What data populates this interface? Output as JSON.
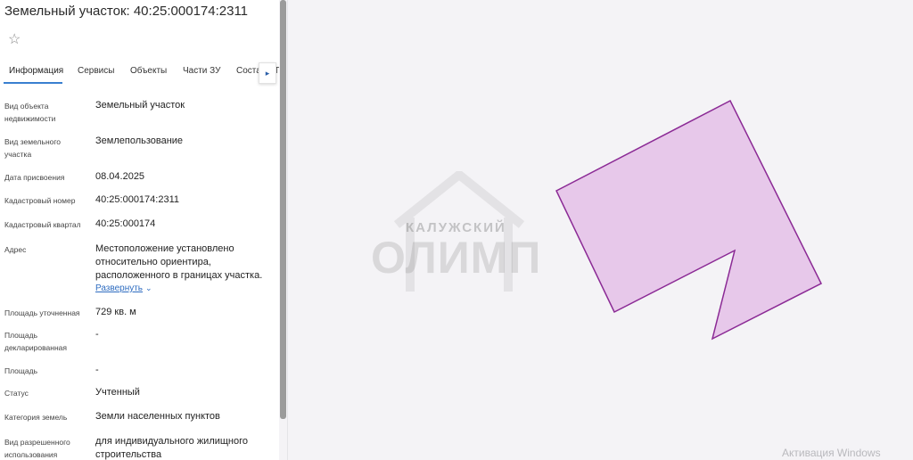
{
  "header": {
    "title": "Земельный участок: 40:25:000174:2311"
  },
  "tabs": [
    {
      "label": "Информация"
    },
    {
      "label": "Сервисы"
    },
    {
      "label": "Объекты"
    },
    {
      "label": "Части ЗУ"
    },
    {
      "label": "Соста"
    },
    {
      "label": "П"
    }
  ],
  "fields": [
    {
      "label": "Вид объекта недвижимости",
      "value": "Земельный участок"
    },
    {
      "label": "Вид земельного участка",
      "value": "Землепользование"
    },
    {
      "label": "Дата присвоения",
      "value": "08.04.2025"
    },
    {
      "label": "Кадастровый номер",
      "value": "40:25:000174:2311"
    },
    {
      "label": "Кадастровый квартал",
      "value": "40:25:000174"
    },
    {
      "label": "Адрес",
      "value": "Местоположение установлено относительно ориентира, расположенного в границах участка."
    },
    {
      "label": "Площадь уточненная",
      "value": "729 кв. м"
    },
    {
      "label": "Площадь декларированная",
      "value": "-"
    },
    {
      "label": "Площадь",
      "value": "-"
    },
    {
      "label": "Статус",
      "value": "Учтенный"
    },
    {
      "label": "Категория земель",
      "value": "Земли населенных пунктов"
    },
    {
      "label": "Вид разрешенного использования",
      "value": "для индивидуального жилищного строительства"
    }
  ],
  "address_expand": {
    "label": "Развернуть"
  },
  "watermark": {
    "line1": "КАЛУЖСКИЙ",
    "line2": "ОЛИМП"
  },
  "os": {
    "activation": "Активация Windows"
  },
  "colors": {
    "parcel_fill": "#e7c8ea",
    "parcel_stroke": "#8b2a95",
    "link": "#2e6cc0",
    "tab_active": "#3a7fd0"
  },
  "icons": {
    "favorite": "star-outline-icon",
    "tab_scroll": "chevron-right-icon",
    "expand": "chevron-down-icon"
  }
}
